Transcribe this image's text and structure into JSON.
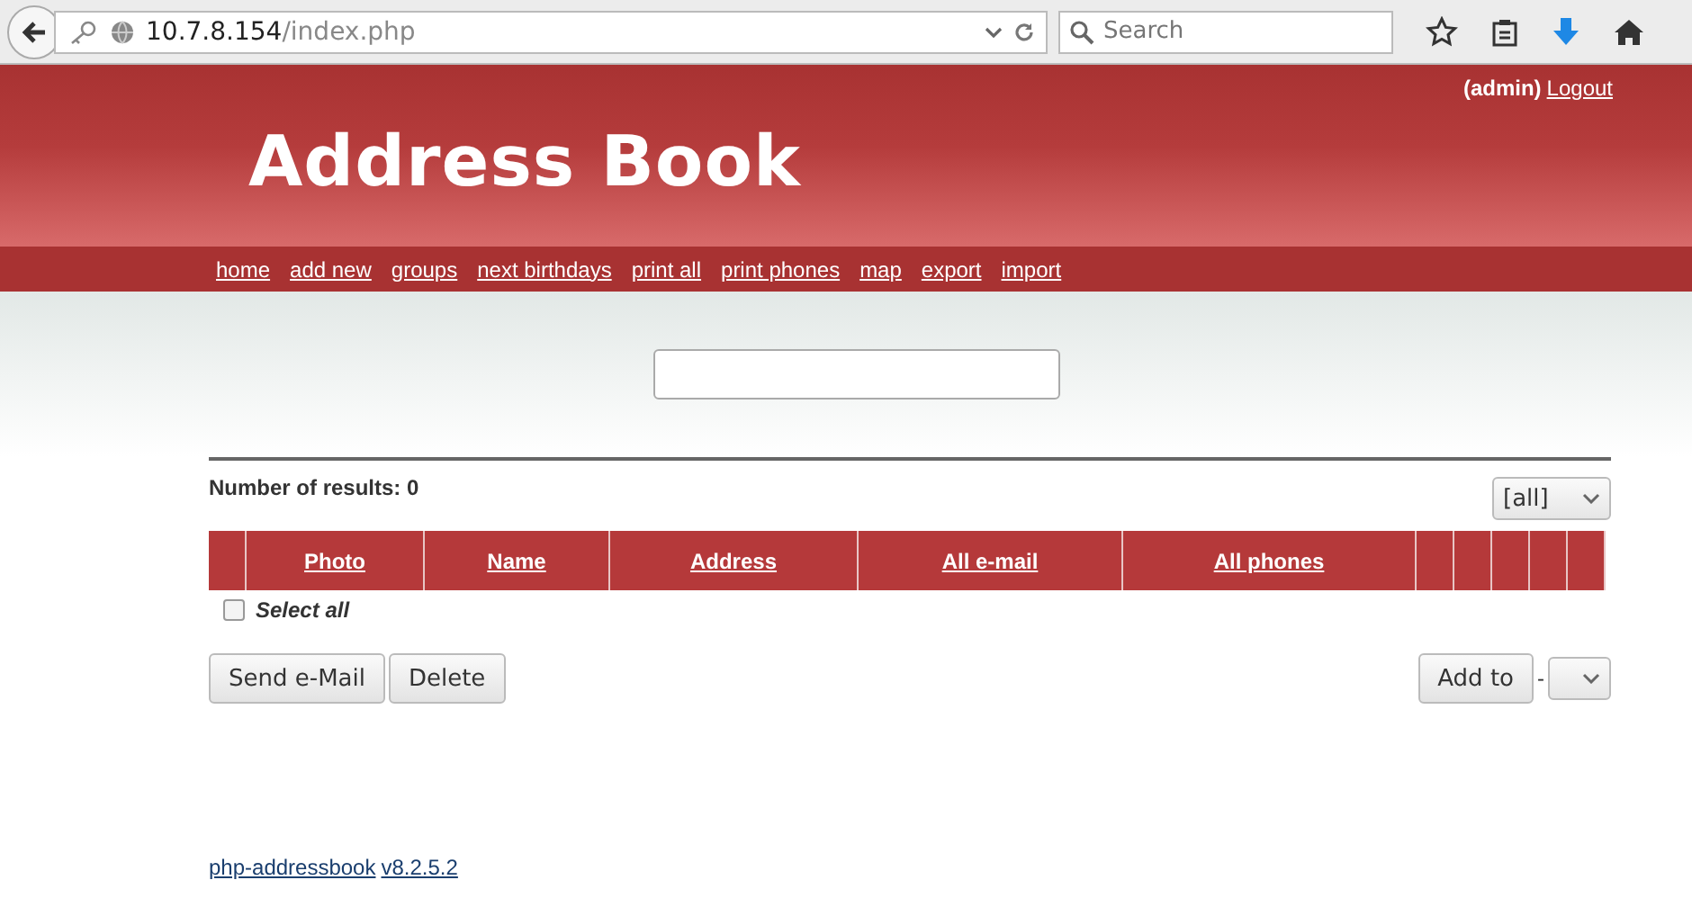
{
  "browser": {
    "url_host": "10.7.8.154",
    "url_path": "/index.php",
    "search_placeholder": "Search"
  },
  "header": {
    "user": "(admin)",
    "logout": "Logout",
    "title": "Address Book"
  },
  "nav": [
    "home",
    "add new",
    "groups",
    "next birthdays",
    "print all",
    "print phones",
    "map",
    "export",
    "import"
  ],
  "results_label": "Number of results: 0",
  "group_select": "[all]",
  "table": {
    "columns": [
      "",
      "Photo",
      "Name",
      "Address",
      "All e-mail",
      "All phones",
      "",
      "",
      "",
      "",
      ""
    ]
  },
  "select_all": {
    "label": "Select all",
    "checked": false
  },
  "buttons": [
    "Send e-Mail",
    "Delete"
  ],
  "add_to": {
    "label": "Add to",
    "separator": "-"
  },
  "footer": {
    "name": "php-addressbook",
    "version": "v8.2.5.2"
  }
}
